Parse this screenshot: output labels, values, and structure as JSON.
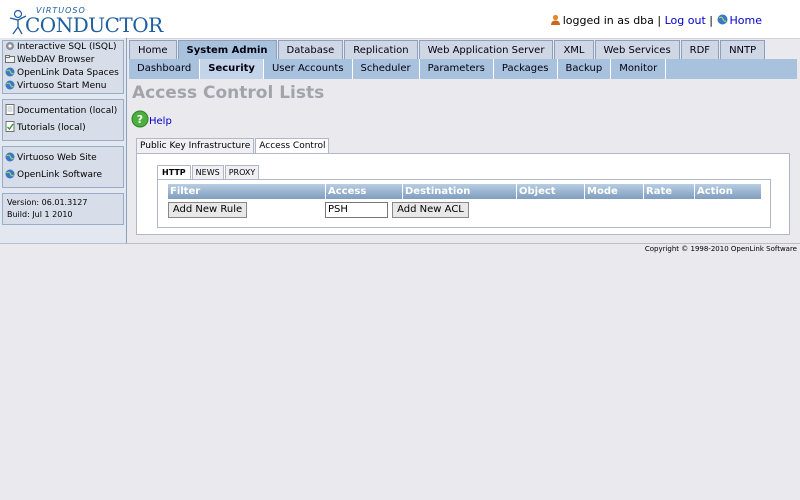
{
  "header": {
    "logo_small": "VIRTUOSO",
    "logo_big": "CONDUCTOR",
    "logged_in_text": "logged in as dba",
    "sep1": "|",
    "logout_label": "Log out",
    "sep2": "|",
    "home_label": "Home"
  },
  "sidebar": {
    "group1": [
      "Interactive SQL (ISQL)",
      "WebDAV Browser",
      "OpenLink Data Spaces",
      "Virtuoso Start Menu"
    ],
    "group2": [
      "Documentation (local)",
      "Tutorials (local)"
    ],
    "group3": [
      "Virtuoso Web Site",
      "OpenLink Software"
    ],
    "version": "Version: 06.01.3127",
    "build": "Build: Jul 1 2010"
  },
  "nav_main": [
    "Home",
    "System Admin",
    "Database",
    "Replication",
    "Web Application Server",
    "XML",
    "Web Services",
    "RDF",
    "NNTP"
  ],
  "nav_main_active": "System Admin",
  "nav_sub": [
    "Dashboard",
    "Security",
    "User Accounts",
    "Scheduler",
    "Parameters",
    "Packages",
    "Backup",
    "Monitor"
  ],
  "nav_sub_active": "Security",
  "page": {
    "title": "Access Control Lists",
    "help_label": "Help"
  },
  "panel_tabs": [
    "Public Key Infrastructure",
    "Access Control"
  ],
  "inner_tabs": [
    "HTTP",
    "NEWS",
    "PROXY"
  ],
  "table": {
    "columns": [
      "Filter",
      "Access",
      "Destination",
      "Object",
      "Mode",
      "Rate",
      "Action"
    ],
    "add_rule_label": "Add New Rule",
    "access_value": "PSH",
    "add_acl_label": "Add New ACL"
  },
  "footer": {
    "copyright": "Copyright © 1998-2010 OpenLink Software"
  },
  "colors": {
    "accent": "#1f5fa0",
    "nav_bg": "#a8c1dc",
    "header_grad_dark": "#7f9dbd"
  }
}
